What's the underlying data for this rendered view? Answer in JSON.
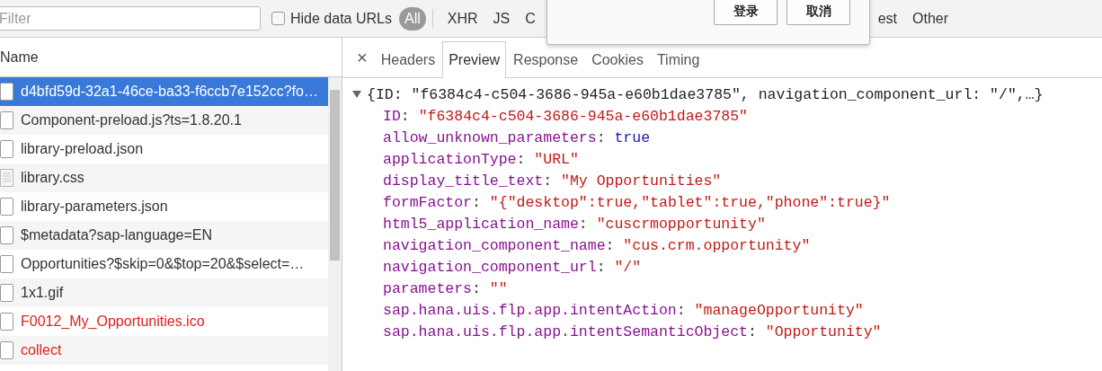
{
  "toolbar": {
    "filter": {
      "placeholder": "Filter"
    },
    "hide_data_urls": {
      "label": "Hide data URLs",
      "checked": false
    },
    "types": [
      {
        "label": "All",
        "selected": true
      },
      {
        "label": "XHR",
        "selected": false
      },
      {
        "label": "JS",
        "selected": false
      },
      {
        "label": "C",
        "selected": false
      },
      {
        "label": "est",
        "selected": false
      },
      {
        "label": "Other",
        "selected": false
      }
    ]
  },
  "dialog": {
    "buttons": [
      "登录",
      "取消"
    ]
  },
  "requests": {
    "column": "Name",
    "rows": [
      {
        "name": "d4bfd59d-32a1-46ce-ba33-f6ccb7e152cc?fo…",
        "kind": "document",
        "selected": true,
        "failed": false
      },
      {
        "name": "Component-preload.js?ts=1.8.20.1",
        "kind": "document",
        "selected": false,
        "failed": false
      },
      {
        "name": "library-preload.json",
        "kind": "document",
        "selected": false,
        "failed": false
      },
      {
        "name": "library.css",
        "kind": "stylesheet",
        "selected": false,
        "failed": false
      },
      {
        "name": "library-parameters.json",
        "kind": "document",
        "selected": false,
        "failed": false
      },
      {
        "name": "$metadata?sap-language=EN",
        "kind": "document",
        "selected": false,
        "failed": false
      },
      {
        "name": "Opportunities?$skip=0&$top=20&$select=…",
        "kind": "document",
        "selected": false,
        "failed": false
      },
      {
        "name": "1x1.gif",
        "kind": "document",
        "selected": false,
        "failed": false
      },
      {
        "name": "F0012_My_Opportunities.ico",
        "kind": "document",
        "selected": false,
        "failed": true
      },
      {
        "name": "collect",
        "kind": "document",
        "selected": false,
        "failed": true
      }
    ]
  },
  "detail": {
    "close": "×",
    "tabs": [
      {
        "label": "Headers",
        "selected": false
      },
      {
        "label": "Preview",
        "selected": true
      },
      {
        "label": "Response",
        "selected": false
      },
      {
        "label": "Cookies",
        "selected": false
      },
      {
        "label": "Timing",
        "selected": false
      }
    ],
    "preview": {
      "expanded": true,
      "separator": ":",
      "summary": "{ID: \"f6384c4-c504-3686-945a-e60b1dae3785\", navigation_component_url: \"/\",…}",
      "properties": [
        {
          "key": "ID",
          "value": "\"f6384c4-c504-3686-945a-e60b1dae3785\"",
          "kind": "string"
        },
        {
          "key": "allow_unknown_parameters",
          "value": "true",
          "kind": "boolean"
        },
        {
          "key": "applicationType",
          "value": "\"URL\"",
          "kind": "string"
        },
        {
          "key": "display_title_text",
          "value": "\"My Opportunities\"",
          "kind": "string"
        },
        {
          "key": "formFactor",
          "value": "\"{\"desktop\":true,\"tablet\":true,\"phone\":true}\"",
          "kind": "string"
        },
        {
          "key": "html5_application_name",
          "value": "\"cuscrmopportunity\"",
          "kind": "string"
        },
        {
          "key": "navigation_component_name",
          "value": "\"cus.crm.opportunity\"",
          "kind": "string"
        },
        {
          "key": "navigation_component_url",
          "value": "\"/\"",
          "kind": "string"
        },
        {
          "key": "parameters",
          "value": "\"\"",
          "kind": "string"
        },
        {
          "key": "sap.hana.uis.flp.app.intentAction",
          "value": "\"manageOpportunity\"",
          "kind": "string"
        },
        {
          "key": "sap.hana.uis.flp.app.intentSemanticObject",
          "value": "\"Opportunity\"",
          "kind": "string"
        }
      ]
    }
  }
}
